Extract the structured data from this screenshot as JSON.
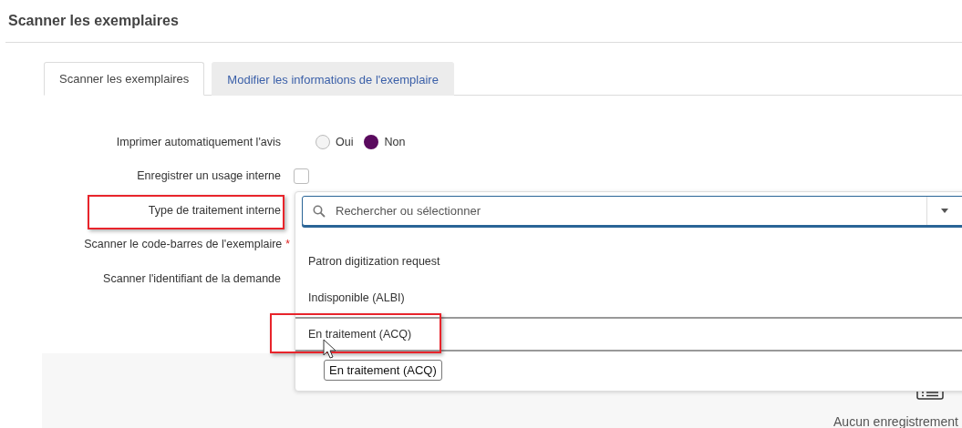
{
  "page_title": "Scanner les exemplaires",
  "tabs": [
    {
      "label": "Scanner les exemplaires",
      "selected": true
    },
    {
      "label": "Modifier les informations de l'exemplaire",
      "selected": false
    }
  ],
  "fields": [
    {
      "kind": "radio",
      "label": "Imprimer automatiquement l'avis",
      "highlighted": false,
      "options": [
        {
          "label": "Oui",
          "selected": false
        },
        {
          "label": "Non",
          "selected": true
        }
      ]
    },
    {
      "kind": "checkbox",
      "label": "Enregistrer un usage interne",
      "highlighted": false,
      "checked": false
    },
    {
      "kind": "select",
      "label": "Type de traitement interne",
      "highlighted": true,
      "placeholder": "Rechercher ou sélectionner",
      "expanded": true,
      "options": [
        {
          "label": "Patron digitization request",
          "hovered": false,
          "highlighted": false
        },
        {
          "label": "Indisponible (ALBI)",
          "hovered": false,
          "highlighted": false
        },
        {
          "label": "En traitement (ACQ)",
          "hovered": true,
          "highlighted": true
        }
      ]
    },
    {
      "kind": "text",
      "label": "Scanner le code-barres de l'exemplaire",
      "required_mark": "*",
      "highlighted": false
    },
    {
      "kind": "text",
      "label": "Scanner l'identifiant de la demande",
      "highlighted": false
    }
  ],
  "tooltip": "En traitement (ACQ)",
  "results": {
    "empty_text": "Aucun enregistrement"
  }
}
